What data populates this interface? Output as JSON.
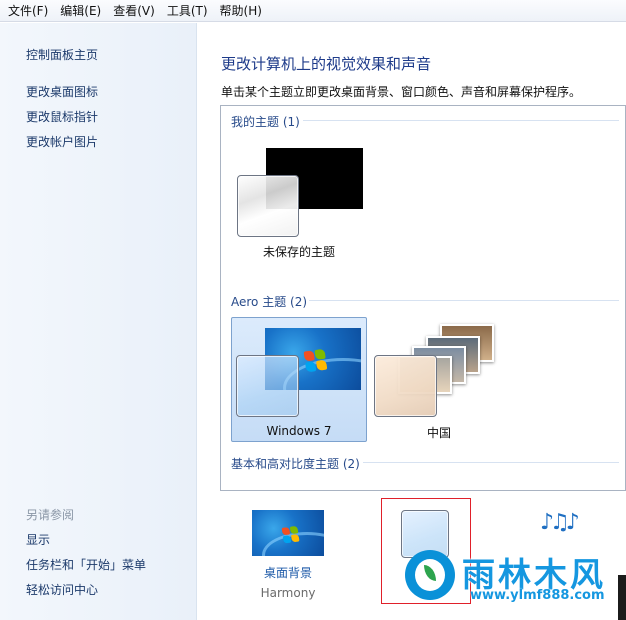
{
  "menu": [
    "文件(F)",
    "编辑(E)",
    "查看(V)",
    "工具(T)",
    "帮助(H)"
  ],
  "sidebar": {
    "home": "控制面板主页",
    "links": [
      "更改桌面图标",
      "更改鼠标指针",
      "更改帐户图片"
    ],
    "see_also_heading": "另请参阅",
    "see_also": [
      "显示",
      "任务栏和「开始」菜单",
      "轻松访问中心"
    ]
  },
  "main": {
    "title": "更改计算机上的视觉效果和声音",
    "description": "单击某个主题立即更改桌面背景、窗口颜色、声音和屏幕保护程序。",
    "groups": {
      "my_themes": {
        "header": "我的主题 (1)",
        "items": [
          "未保存的主题"
        ]
      },
      "aero_themes": {
        "header": "Aero 主题 (2)",
        "items": [
          "Windows 7",
          "中国"
        ],
        "selected": "Windows 7"
      },
      "basic_themes": {
        "header": "基本和高对比度主题 (2)"
      }
    },
    "bottom": {
      "desktop_background": {
        "label": "桌面背景",
        "value": "Harmony"
      }
    }
  },
  "watermark": {
    "brand": "雨林木风",
    "url": "www.ylmf888.com"
  },
  "colors": {
    "link": "#1c3a6b",
    "title": "#1e3b8a",
    "selection": "#c5dcf6",
    "frame": "#e0202a",
    "watermark": "#1597e0"
  }
}
